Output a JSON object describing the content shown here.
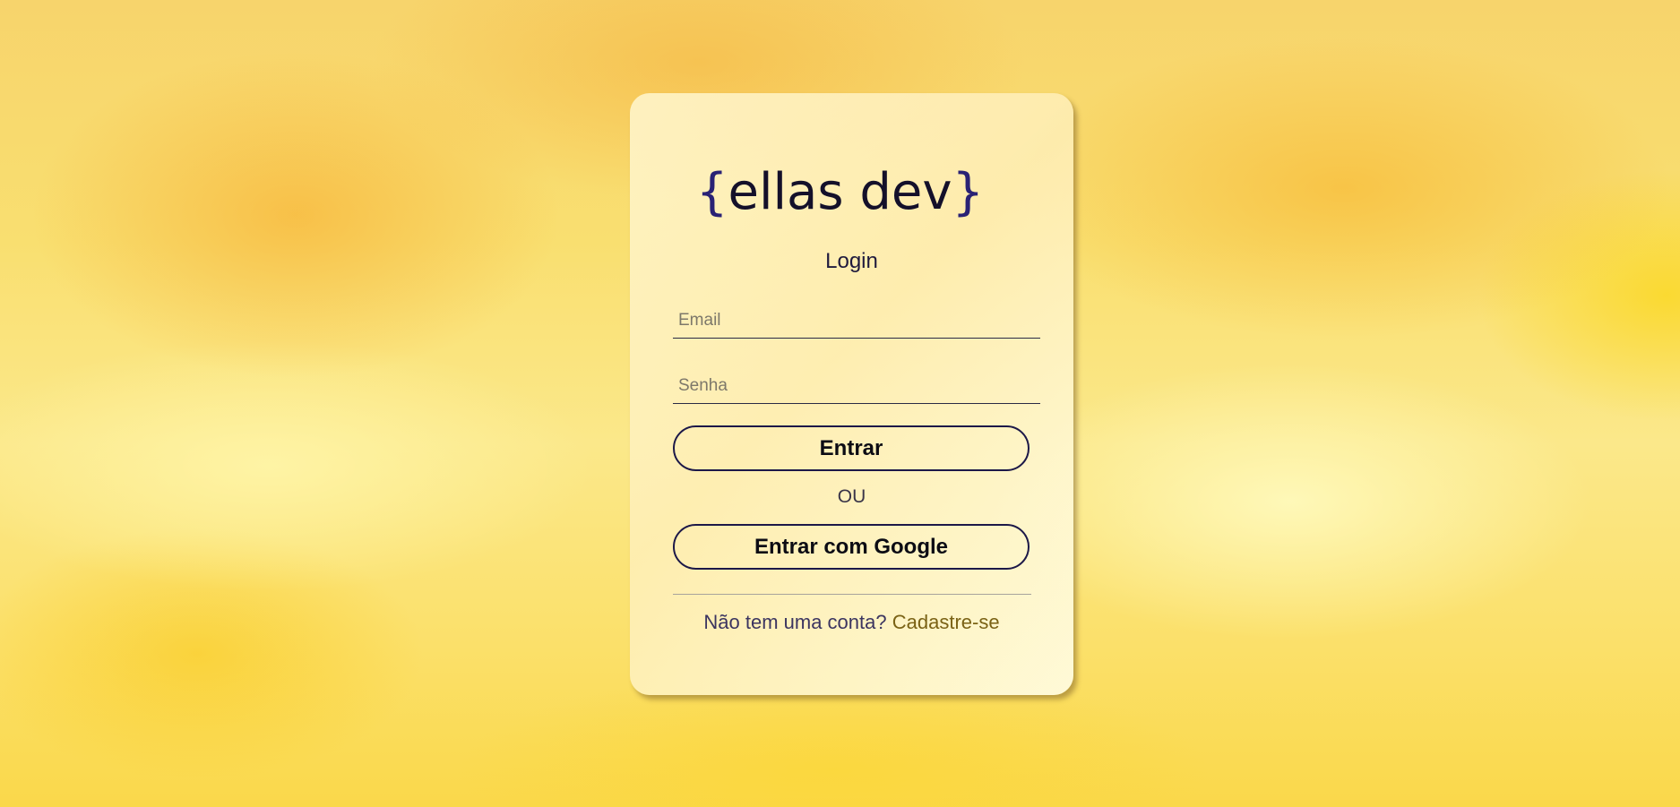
{
  "logo": {
    "open_brace": "{",
    "name": "ellas dev",
    "close_brace": "}"
  },
  "login": {
    "title": "Login",
    "email_placeholder": "Email",
    "senha_placeholder": "Senha",
    "submit_label": "Entrar",
    "separator": "OU",
    "google_label": "Entrar com Google",
    "signup_prompt": "Não tem uma conta?",
    "signup_link": "Cadastre-se"
  },
  "colors": {
    "accent": "#1c1848",
    "link": "#7a6215"
  }
}
